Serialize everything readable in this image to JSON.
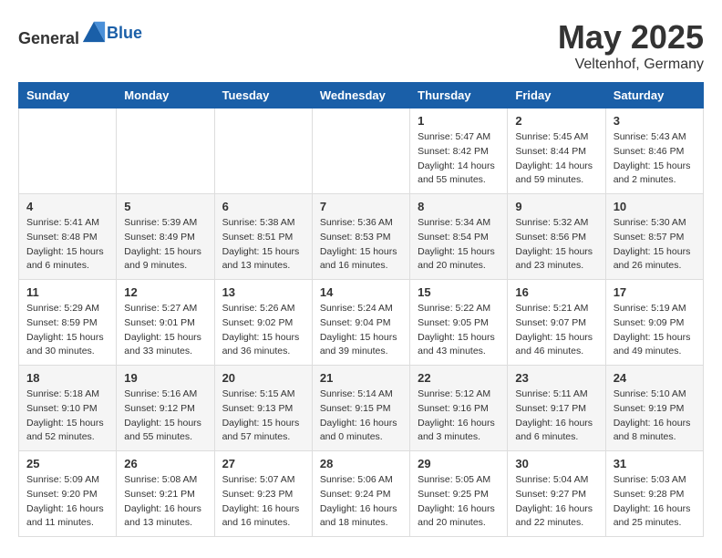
{
  "header": {
    "logo": {
      "text_general": "General",
      "text_blue": "Blue"
    },
    "title": "May 2025",
    "subtitle": "Veltenhof, Germany"
  },
  "weekdays": [
    "Sunday",
    "Monday",
    "Tuesday",
    "Wednesday",
    "Thursday",
    "Friday",
    "Saturday"
  ],
  "weeks": [
    [
      {
        "day": "",
        "info": ""
      },
      {
        "day": "",
        "info": ""
      },
      {
        "day": "",
        "info": ""
      },
      {
        "day": "",
        "info": ""
      },
      {
        "day": "1",
        "info": "Sunrise: 5:47 AM\nSunset: 8:42 PM\nDaylight: 14 hours\nand 55 minutes."
      },
      {
        "day": "2",
        "info": "Sunrise: 5:45 AM\nSunset: 8:44 PM\nDaylight: 14 hours\nand 59 minutes."
      },
      {
        "day": "3",
        "info": "Sunrise: 5:43 AM\nSunset: 8:46 PM\nDaylight: 15 hours\nand 2 minutes."
      }
    ],
    [
      {
        "day": "4",
        "info": "Sunrise: 5:41 AM\nSunset: 8:48 PM\nDaylight: 15 hours\nand 6 minutes."
      },
      {
        "day": "5",
        "info": "Sunrise: 5:39 AM\nSunset: 8:49 PM\nDaylight: 15 hours\nand 9 minutes."
      },
      {
        "day": "6",
        "info": "Sunrise: 5:38 AM\nSunset: 8:51 PM\nDaylight: 15 hours\nand 13 minutes."
      },
      {
        "day": "7",
        "info": "Sunrise: 5:36 AM\nSunset: 8:53 PM\nDaylight: 15 hours\nand 16 minutes."
      },
      {
        "day": "8",
        "info": "Sunrise: 5:34 AM\nSunset: 8:54 PM\nDaylight: 15 hours\nand 20 minutes."
      },
      {
        "day": "9",
        "info": "Sunrise: 5:32 AM\nSunset: 8:56 PM\nDaylight: 15 hours\nand 23 minutes."
      },
      {
        "day": "10",
        "info": "Sunrise: 5:30 AM\nSunset: 8:57 PM\nDaylight: 15 hours\nand 26 minutes."
      }
    ],
    [
      {
        "day": "11",
        "info": "Sunrise: 5:29 AM\nSunset: 8:59 PM\nDaylight: 15 hours\nand 30 minutes."
      },
      {
        "day": "12",
        "info": "Sunrise: 5:27 AM\nSunset: 9:01 PM\nDaylight: 15 hours\nand 33 minutes."
      },
      {
        "day": "13",
        "info": "Sunrise: 5:26 AM\nSunset: 9:02 PM\nDaylight: 15 hours\nand 36 minutes."
      },
      {
        "day": "14",
        "info": "Sunrise: 5:24 AM\nSunset: 9:04 PM\nDaylight: 15 hours\nand 39 minutes."
      },
      {
        "day": "15",
        "info": "Sunrise: 5:22 AM\nSunset: 9:05 PM\nDaylight: 15 hours\nand 43 minutes."
      },
      {
        "day": "16",
        "info": "Sunrise: 5:21 AM\nSunset: 9:07 PM\nDaylight: 15 hours\nand 46 minutes."
      },
      {
        "day": "17",
        "info": "Sunrise: 5:19 AM\nSunset: 9:09 PM\nDaylight: 15 hours\nand 49 minutes."
      }
    ],
    [
      {
        "day": "18",
        "info": "Sunrise: 5:18 AM\nSunset: 9:10 PM\nDaylight: 15 hours\nand 52 minutes."
      },
      {
        "day": "19",
        "info": "Sunrise: 5:16 AM\nSunset: 9:12 PM\nDaylight: 15 hours\nand 55 minutes."
      },
      {
        "day": "20",
        "info": "Sunrise: 5:15 AM\nSunset: 9:13 PM\nDaylight: 15 hours\nand 57 minutes."
      },
      {
        "day": "21",
        "info": "Sunrise: 5:14 AM\nSunset: 9:15 PM\nDaylight: 16 hours\nand 0 minutes."
      },
      {
        "day": "22",
        "info": "Sunrise: 5:12 AM\nSunset: 9:16 PM\nDaylight: 16 hours\nand 3 minutes."
      },
      {
        "day": "23",
        "info": "Sunrise: 5:11 AM\nSunset: 9:17 PM\nDaylight: 16 hours\nand 6 minutes."
      },
      {
        "day": "24",
        "info": "Sunrise: 5:10 AM\nSunset: 9:19 PM\nDaylight: 16 hours\nand 8 minutes."
      }
    ],
    [
      {
        "day": "25",
        "info": "Sunrise: 5:09 AM\nSunset: 9:20 PM\nDaylight: 16 hours\nand 11 minutes."
      },
      {
        "day": "26",
        "info": "Sunrise: 5:08 AM\nSunset: 9:21 PM\nDaylight: 16 hours\nand 13 minutes."
      },
      {
        "day": "27",
        "info": "Sunrise: 5:07 AM\nSunset: 9:23 PM\nDaylight: 16 hours\nand 16 minutes."
      },
      {
        "day": "28",
        "info": "Sunrise: 5:06 AM\nSunset: 9:24 PM\nDaylight: 16 hours\nand 18 minutes."
      },
      {
        "day": "29",
        "info": "Sunrise: 5:05 AM\nSunset: 9:25 PM\nDaylight: 16 hours\nand 20 minutes."
      },
      {
        "day": "30",
        "info": "Sunrise: 5:04 AM\nSunset: 9:27 PM\nDaylight: 16 hours\nand 22 minutes."
      },
      {
        "day": "31",
        "info": "Sunrise: 5:03 AM\nSunset: 9:28 PM\nDaylight: 16 hours\nand 25 minutes."
      }
    ]
  ]
}
